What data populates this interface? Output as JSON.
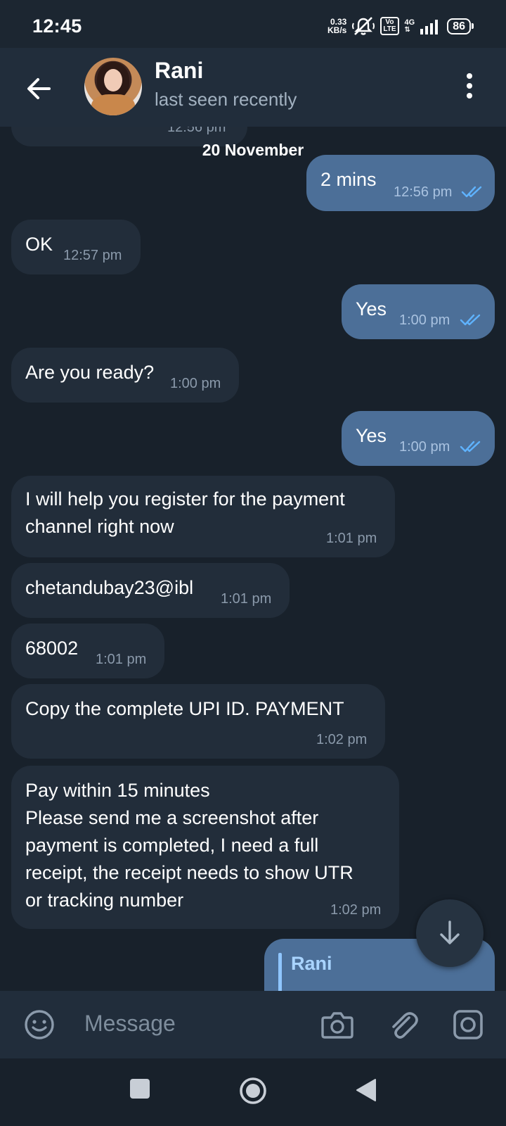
{
  "status_bar": {
    "time": "12:45",
    "speed_value": "0.33",
    "speed_unit": "KB/s",
    "volte_top": "Vo",
    "volte_bottom": "LTE",
    "network": "4G",
    "battery": "86"
  },
  "header": {
    "name": "Rani",
    "status": "last seen recently"
  },
  "chat": {
    "partial_top_time": "12:56 pm",
    "date_separator": "20 November",
    "messages": [
      {
        "dir": "out",
        "text": "2 mins",
        "time": "12:56 pm"
      },
      {
        "dir": "in",
        "text": "OK",
        "time": "12:57 pm"
      },
      {
        "dir": "out",
        "text": "Yes",
        "time": "1:00 pm"
      },
      {
        "dir": "in",
        "text": "Are you ready?",
        "time": "1:00 pm"
      },
      {
        "dir": "out",
        "text": "Yes",
        "time": "1:00 pm"
      },
      {
        "dir": "in",
        "lines": [
          "I will help you register for the payment",
          "channel right now"
        ],
        "time": "1:01 pm"
      },
      {
        "dir": "in",
        "text": "chetandubay23@ibl",
        "time": "1:01 pm"
      },
      {
        "dir": "in",
        "text": "68002",
        "time": "1:01 pm"
      },
      {
        "dir": "in",
        "text": "Copy the complete UPI ID.  PAYMENT",
        "time": "1:02 pm"
      },
      {
        "dir": "in",
        "lines": [
          "Pay within 15 minutes",
          "Please send me a screenshot after",
          "payment is completed, I need a full",
          "receipt, the receipt needs to show UTR",
          "or tracking number"
        ],
        "time": "1:02 pm"
      }
    ],
    "reply_preview_name": "Rani"
  },
  "input": {
    "placeholder": "Message"
  },
  "icons": {
    "back": "arrow-left-icon",
    "menu": "more-vertical-icon",
    "emoji": "smile-icon",
    "camera": "camera-icon",
    "attach": "paperclip-icon",
    "video": "video-message-icon",
    "scroll": "arrow-down-icon",
    "read": "double-check-icon"
  },
  "colors": {
    "background": "#18212b",
    "header": "#212d3b",
    "incoming_bubble": "#222d3a",
    "outgoing_bubble": "#4c6f98",
    "read_ticks": "#5fb3ff"
  }
}
